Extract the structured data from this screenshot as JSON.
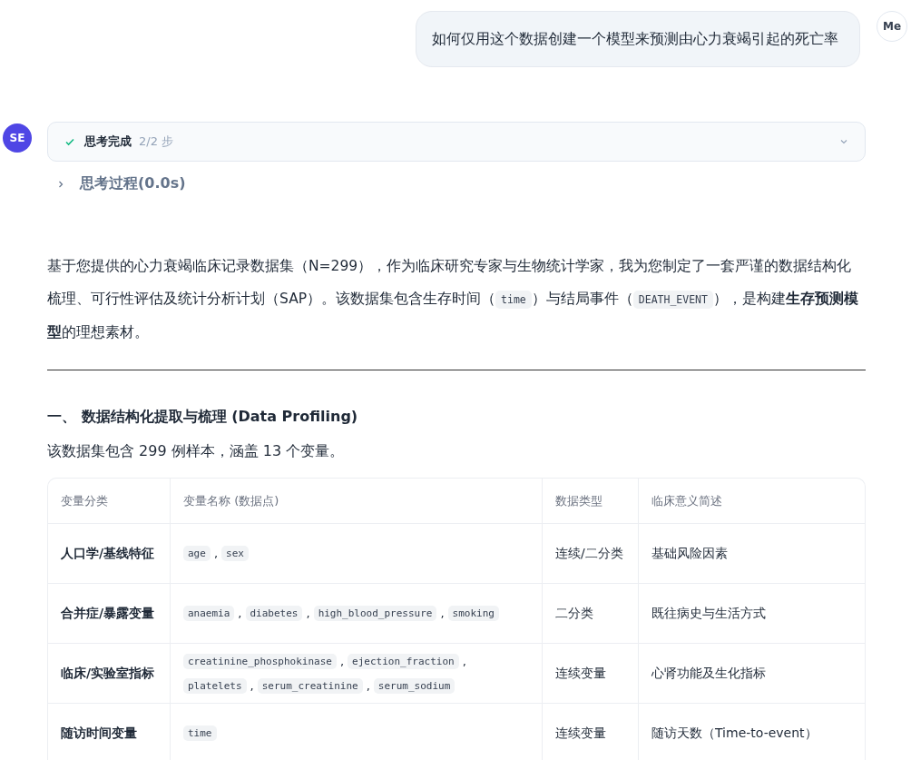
{
  "user_message": {
    "avatar": "Me",
    "text": "如何仅用这个数据创建一个模型来预测由心力衰竭引起的死亡率"
  },
  "assistant": {
    "avatar": "SE",
    "status": {
      "label": "思考完成",
      "steps": "2/2 步",
      "done": true,
      "expanded": false
    },
    "thinking": {
      "label": "思考过程(0.0s)",
      "expanded": false
    },
    "intro": [
      {
        "text": "基于您提供的心力衰竭临床记录数据集（N=299），作为临床研究专家与生物统计学家，我为您制定了一套严谨的数据结构化梳理、可行性评估及统计分析计划（SAP）。该数据集包含生存时间（"
      },
      {
        "code": "time"
      },
      {
        "text": "）与结局事件（"
      },
      {
        "code": "DEATH_EVENT"
      },
      {
        "text": "），是构建**生存预测模型**的理想素材。"
      }
    ],
    "section_heading": "一、 数据结构化提取与梳理 (Data Profiling)",
    "section_text": "该数据集包含 299 例样本，涵盖 13 个变量。",
    "table": {
      "columns": [
        "变量分类",
        "变量名称 (数据点)",
        "数据类型",
        "临床意义简述"
      ],
      "rows": [
        {
          "category": "人口学/基线特征",
          "variables": [
            {
              "code": "age"
            },
            {
              "text": ","
            },
            {
              "code": "sex"
            }
          ],
          "type": "连续/二分类",
          "meaning": "基础风险因素"
        },
        {
          "category": "合并症/暴露变量",
          "variables": [
            {
              "code": "anaemia"
            },
            {
              "text": ","
            },
            {
              "code": "diabetes"
            },
            {
              "text": ","
            },
            {
              "code": "high_blood_pressure"
            },
            {
              "text": ","
            },
            {
              "code": "smoking"
            }
          ],
          "type": "二分类",
          "meaning": "既往病史与生活方式"
        },
        {
          "category": "临床/实验室指标",
          "variables": [
            {
              "code": "creatinine_phosphokinase"
            },
            {
              "text": ","
            },
            {
              "code": "ejection_fraction"
            },
            {
              "text": ","
            },
            {
              "code": "platelets"
            },
            {
              "text": ","
            },
            {
              "code": "serum_creatinine"
            },
            {
              "text": ","
            },
            {
              "code": "serum_sodium"
            }
          ],
          "type": "连续变量",
          "meaning": "心肾功能及生化指标"
        },
        {
          "category": "随访时间变量",
          "variables": [
            {
              "code": "time"
            }
          ],
          "type": "连续变量",
          "meaning": "随访天数（Time-to-event）"
        }
      ]
    }
  }
}
